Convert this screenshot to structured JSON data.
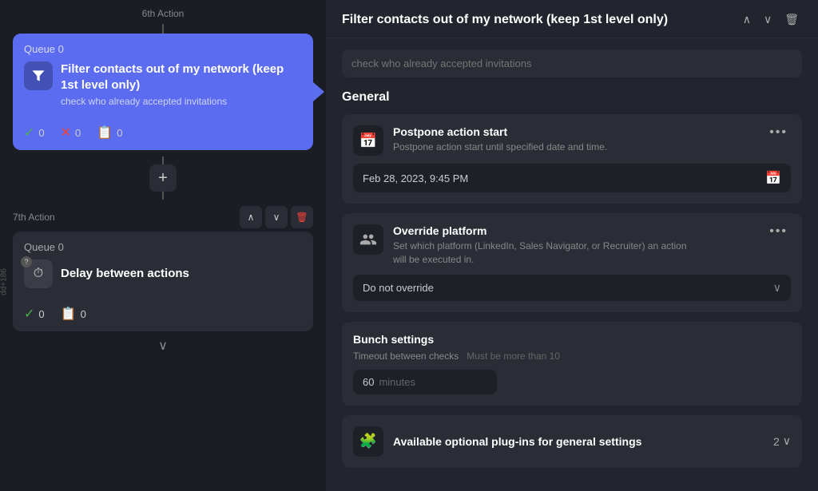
{
  "left": {
    "sixth_action_label": "6th Action",
    "top_card": {
      "queue_label": "Queue",
      "queue_count": "0",
      "title": "Filter contacts out of my network (keep 1st level only)",
      "subtitle": "check who already accepted invitations",
      "stats": {
        "success": "0",
        "fail": "0",
        "skip": "0"
      }
    },
    "seventh_action_label": "7th Action",
    "seventh_card": {
      "queue_label": "Queue",
      "queue_count": "0",
      "title": "Delay between actions",
      "stats": {
        "success": "0",
        "skip": "0"
      }
    },
    "side_label": "dd+186",
    "add_button_label": "+",
    "down_arrow": "∨"
  },
  "right": {
    "header": {
      "title": "Filter contacts out of my network (keep 1st level only)",
      "up_label": "∧",
      "down_label": "∨",
      "delete_label": "🗑"
    },
    "notes_placeholder": "check who already accepted invitations",
    "general_section": {
      "title": "General",
      "postpone_card": {
        "icon": "📅",
        "title": "Postpone action start",
        "description": "Postpone action start until specified date and time.",
        "date_value": "Feb 28, 2023, 9:45 PM",
        "more_label": "•••"
      },
      "override_card": {
        "icon": "👤",
        "title": "Override platform",
        "description": "Set which platform (LinkedIn, Sales Navigator, or Recruiter) an action will be executed in.",
        "select_value": "Do not override",
        "more_label": "•••"
      }
    },
    "bunch_settings": {
      "title": "Bunch settings",
      "timeout_label": "Timeout between checks",
      "must_be_label": "Must be more than 10",
      "minutes_value": "60",
      "minutes_unit": "minutes"
    },
    "plugins": {
      "icon": "🧩",
      "title": "Available optional plug-ins for general settings",
      "count": "2",
      "chevron": "∨"
    }
  }
}
